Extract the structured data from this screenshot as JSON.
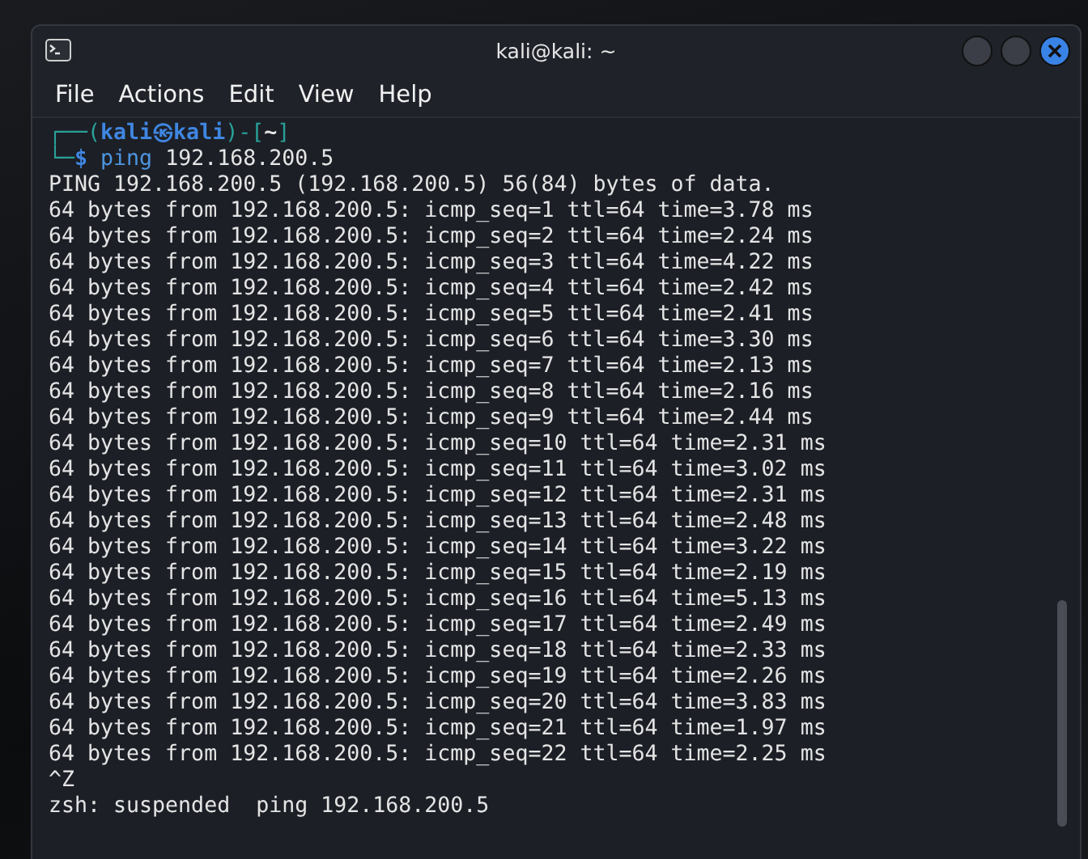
{
  "window": {
    "title": "kali@kali: ~"
  },
  "menu": [
    "File",
    "Actions",
    "Edit",
    "View",
    "Help"
  ],
  "prompt": [
    [
      {
        "kind": "frame",
        "text": "┌──("
      },
      {
        "kind": "user",
        "text": "kali㉿kali"
      },
      {
        "kind": "frame",
        "text": ")-["
      },
      {
        "kind": "dir",
        "text": "~"
      },
      {
        "kind": "frame",
        "text": "]"
      }
    ],
    [
      {
        "kind": "frame",
        "text": "└─"
      },
      {
        "kind": "sign",
        "text": "$"
      },
      {
        "kind": "command",
        "text": " ping"
      },
      {
        "kind": "plain",
        "text": " 192.168.200.5"
      }
    ]
  ],
  "output": [
    "PING 192.168.200.5 (192.168.200.5) 56(84) bytes of data.",
    "64 bytes from 192.168.200.5: icmp_seq=1 ttl=64 time=3.78 ms",
    "64 bytes from 192.168.200.5: icmp_seq=2 ttl=64 time=2.24 ms",
    "64 bytes from 192.168.200.5: icmp_seq=3 ttl=64 time=4.22 ms",
    "64 bytes from 192.168.200.5: icmp_seq=4 ttl=64 time=2.42 ms",
    "64 bytes from 192.168.200.5: icmp_seq=5 ttl=64 time=2.41 ms",
    "64 bytes from 192.168.200.5: icmp_seq=6 ttl=64 time=3.30 ms",
    "64 bytes from 192.168.200.5: icmp_seq=7 ttl=64 time=2.13 ms",
    "64 bytes from 192.168.200.5: icmp_seq=8 ttl=64 time=2.16 ms",
    "64 bytes from 192.168.200.5: icmp_seq=9 ttl=64 time=2.44 ms",
    "64 bytes from 192.168.200.5: icmp_seq=10 ttl=64 time=2.31 ms",
    "64 bytes from 192.168.200.5: icmp_seq=11 ttl=64 time=3.02 ms",
    "64 bytes from 192.168.200.5: icmp_seq=12 ttl=64 time=2.31 ms",
    "64 bytes from 192.168.200.5: icmp_seq=13 ttl=64 time=2.48 ms",
    "64 bytes from 192.168.200.5: icmp_seq=14 ttl=64 time=3.22 ms",
    "64 bytes from 192.168.200.5: icmp_seq=15 ttl=64 time=2.19 ms",
    "64 bytes from 192.168.200.5: icmp_seq=16 ttl=64 time=5.13 ms",
    "64 bytes from 192.168.200.5: icmp_seq=17 ttl=64 time=2.49 ms",
    "64 bytes from 192.168.200.5: icmp_seq=18 ttl=64 time=2.33 ms",
    "64 bytes from 192.168.200.5: icmp_seq=19 ttl=64 time=2.26 ms",
    "64 bytes from 192.168.200.5: icmp_seq=20 ttl=64 time=3.83 ms",
    "64 bytes from 192.168.200.5: icmp_seq=21 ttl=64 time=1.97 ms",
    "64 bytes from 192.168.200.5: icmp_seq=22 ttl=64 time=2.25 ms",
    "^Z",
    "zsh: suspended  ping 192.168.200.5"
  ]
}
